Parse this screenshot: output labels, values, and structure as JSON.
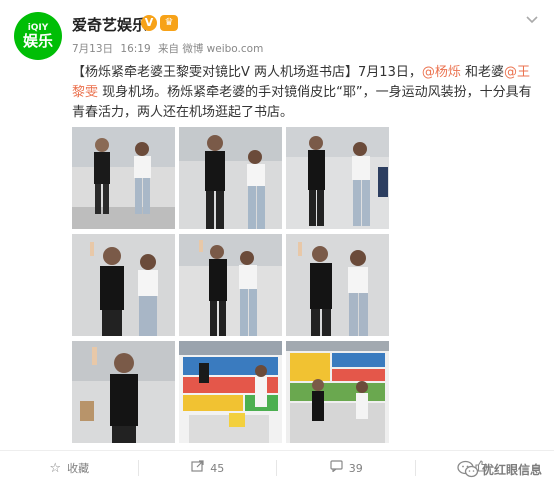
{
  "account": {
    "name": "爱奇艺娱乐",
    "avatar_line1": "iQIY",
    "avatar_line2": "娱乐",
    "verified_glyph": "V",
    "member_glyph": "♛"
  },
  "meta": {
    "date": "7月13日",
    "time": "16:19",
    "source": "来自 微博 weibo.com"
  },
  "post": {
    "text_part1": "【杨烁紧牵老婆王黎雯对镜比V 两人机场逛书店】7月13日，",
    "mention1": "@杨烁",
    "text_part2": " 和老婆",
    "mention2": "@王黎雯",
    "text_part3": " 现身机场。杨烁紧牵老婆的手对镜俏皮比“耶”，一身运动风装扮，十分具有青春活力，两人还在机场逛起了书店。"
  },
  "photos": [
    {
      "label": "photo-1"
    },
    {
      "label": "photo-2"
    },
    {
      "label": "photo-3"
    },
    {
      "label": "photo-4"
    },
    {
      "label": "photo-5"
    },
    {
      "label": "photo-6"
    },
    {
      "label": "photo-7"
    },
    {
      "label": "photo-8"
    },
    {
      "label": "photo-9"
    }
  ],
  "footer": {
    "favorite_label": "收藏",
    "repost_count": "45",
    "comment_count": "39",
    "like_count": "",
    "favorite_icon": "star-icon",
    "repost_icon": "repost-icon",
    "comment_icon": "comment-icon",
    "like_icon": "thumbs-up-icon"
  },
  "watermark": {
    "text": "优红眼信息"
  },
  "colors": {
    "brand_green": "#00be06",
    "verified_orange": "#f7a218",
    "link": "#eb7350",
    "muted": "#808080"
  }
}
